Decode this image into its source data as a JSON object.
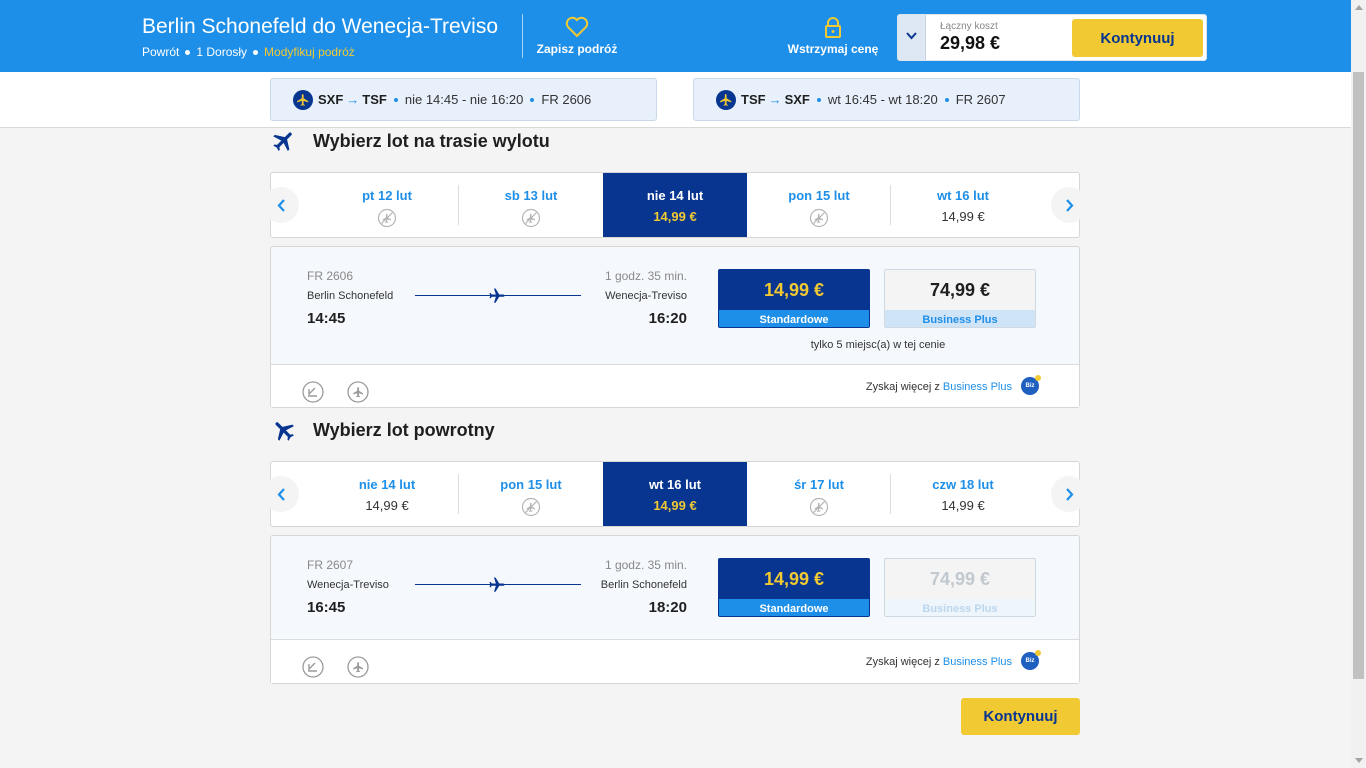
{
  "header": {
    "title": "Berlin Schonefeld do Wenecja-Treviso",
    "trip_type": "Powrót",
    "passengers": "1 Dorosły",
    "modify": "Modyfikuj podróż",
    "save_trip": "Zapisz podróż",
    "hold_price": "Wstrzymaj cenę",
    "total_label": "Łączny koszt",
    "total_value": "29,98 €",
    "continue": "Kontynuuj"
  },
  "legs": [
    {
      "from": "SXF",
      "to": "TSF",
      "times": "nie 14:45 - nie 16:20",
      "flight": "FR 2606"
    },
    {
      "from": "TSF",
      "to": "SXF",
      "times": "wt 16:45 - wt 18:20",
      "flight": "FR 2607"
    }
  ],
  "outbound": {
    "title": "Wybierz lot na trasie wylotu",
    "dates": [
      {
        "label": "pt 12 lut",
        "price": ""
      },
      {
        "label": "sb 13 lut",
        "price": ""
      },
      {
        "label": "nie 14 lut",
        "price": "14,99 €"
      },
      {
        "label": "pon 15 lut",
        "price": ""
      },
      {
        "label": "wt 16 lut",
        "price": "14,99 €"
      }
    ],
    "flight": {
      "number": "FR 2606",
      "from": "Berlin Schonefeld",
      "dep": "14:45",
      "duration": "1 godz. 35 min.",
      "to": "Wenecja-Treviso",
      "arr": "16:20",
      "std_price": "14,99 €",
      "std_label": "Standardowe",
      "biz_price": "74,99 €",
      "biz_label": "Business Plus",
      "seats_note": "tylko 5 miejsc(a) w tej cenie"
    },
    "footer": {
      "get_more": "Zyskaj więcej z",
      "link": "Business Plus",
      "badge": "Biz"
    }
  },
  "return": {
    "title": "Wybierz lot powrotny",
    "dates": [
      {
        "label": "nie 14 lut",
        "price": "14,99 €"
      },
      {
        "label": "pon 15 lut",
        "price": ""
      },
      {
        "label": "wt 16 lut",
        "price": "14,99 €"
      },
      {
        "label": "śr 17 lut",
        "price": ""
      },
      {
        "label": "czw 18 lut",
        "price": "14,99 €"
      }
    ],
    "flight": {
      "number": "FR 2607",
      "from": "Wenecja-Treviso",
      "dep": "16:45",
      "duration": "1 godz. 35 min.",
      "to": "Berlin Schonefeld",
      "arr": "18:20",
      "std_price": "14,99 €",
      "std_label": "Standardowe",
      "biz_price": "74,99 €",
      "biz_label": "Business Plus"
    },
    "footer": {
      "get_more": "Zyskaj więcej z",
      "link": "Business Plus",
      "badge": "Biz"
    }
  },
  "bottom": {
    "continue": "Kontynuuj"
  },
  "colors": {
    "header_blue": "#1e8fe8",
    "navy": "#073590",
    "yellow": "#f1c933"
  }
}
